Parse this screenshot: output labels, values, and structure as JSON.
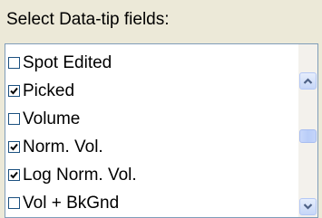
{
  "section": {
    "label": "Select Data-tip fields:"
  },
  "list": {
    "items": [
      {
        "label": "Spot Edited",
        "checked": false
      },
      {
        "label": "Picked",
        "checked": true
      },
      {
        "label": "Volume",
        "checked": false
      },
      {
        "label": "Norm. Vol.",
        "checked": true
      },
      {
        "label": "Log Norm. Vol.",
        "checked": true
      },
      {
        "label": "Vol + BkGnd",
        "checked": false
      }
    ]
  },
  "scrollbar": {
    "up_icon": "scroll-up-arrow-icon",
    "down_icon": "scroll-down-arrow-icon"
  },
  "colors": {
    "background": "#ece9d8",
    "listbox_border": "#7f9db9",
    "checkbox_border": "#1c5180",
    "arrow": "#4d6185"
  }
}
